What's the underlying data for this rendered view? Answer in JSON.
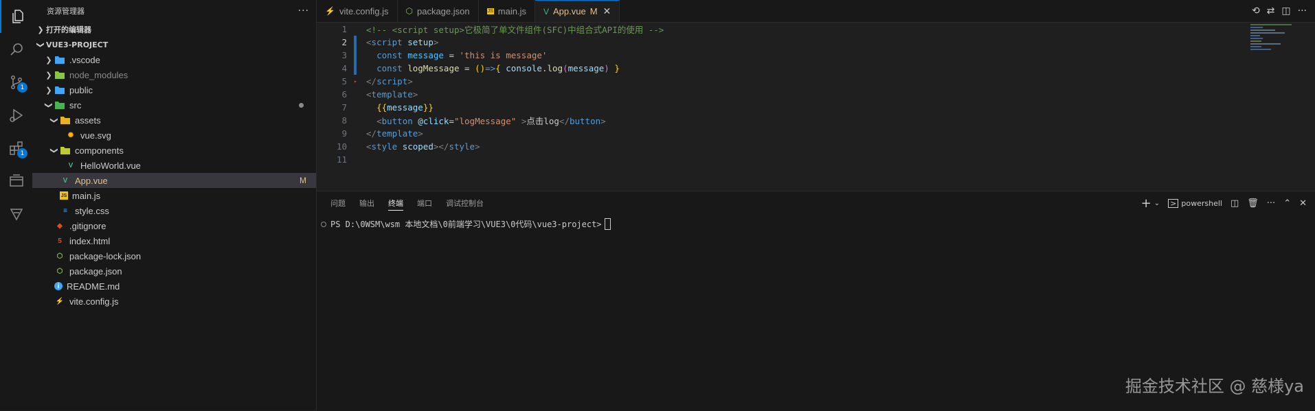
{
  "activity_bar": {
    "items": [
      {
        "icon": "files-icon",
        "badge": ""
      },
      {
        "icon": "search-icon",
        "badge": ""
      },
      {
        "icon": "source-control-icon",
        "badge": "1"
      },
      {
        "icon": "run-debug-icon",
        "badge": ""
      },
      {
        "icon": "extensions-icon",
        "badge": "1"
      },
      {
        "icon": "remote-explorer-icon",
        "badge": ""
      },
      {
        "icon": "testing-icon",
        "badge": ""
      }
    ]
  },
  "sidebar": {
    "title": "资源管理器",
    "more": "···",
    "open_editors": "打开的编辑器",
    "project": "VUE3-PROJECT",
    "tree": [
      {
        "name": ".vscode",
        "type": "folder",
        "depth": 0,
        "open": false,
        "icon_color": "#42a5f5",
        "status": ""
      },
      {
        "name": "node_modules",
        "type": "folder",
        "depth": 0,
        "open": false,
        "icon_color": "#8bc34a",
        "status": "",
        "dim": true
      },
      {
        "name": "public",
        "type": "folder",
        "depth": 0,
        "open": false,
        "icon_color": "#42a5f5",
        "status": ""
      },
      {
        "name": "src",
        "type": "folder",
        "depth": 0,
        "open": true,
        "icon_color": "#4caf50",
        "status": "dot"
      },
      {
        "name": "assets",
        "type": "folder",
        "depth": 1,
        "open": true,
        "icon_color": "#e6b422",
        "status": ""
      },
      {
        "name": "vue.svg",
        "type": "file",
        "depth": 2,
        "icon": "svg-icon",
        "icon_color": "#ffb300",
        "status": ""
      },
      {
        "name": "components",
        "type": "folder",
        "depth": 1,
        "open": true,
        "icon_color": "#c0ca33",
        "status": ""
      },
      {
        "name": "HelloWorld.vue",
        "type": "file",
        "depth": 2,
        "icon": "vue-icon",
        "icon_color": "#41b883",
        "status": ""
      },
      {
        "name": "App.vue",
        "type": "file",
        "depth": 1,
        "icon": "vue-icon",
        "icon_color": "#41b883",
        "status": "M",
        "selected": true,
        "mod": true
      },
      {
        "name": "main.js",
        "type": "file",
        "depth": 1,
        "icon": "js-icon",
        "icon_color": "#f1c40f",
        "status": ""
      },
      {
        "name": "style.css",
        "type": "file",
        "depth": 1,
        "icon": "css-icon",
        "icon_color": "#42a5f5",
        "status": ""
      },
      {
        "name": ".gitignore",
        "type": "file",
        "depth": 0,
        "icon": "git-icon",
        "icon_color": "#e64a19",
        "status": ""
      },
      {
        "name": "index.html",
        "type": "file",
        "depth": 0,
        "icon": "html-icon",
        "icon_color": "#e44d26",
        "status": ""
      },
      {
        "name": "package-lock.json",
        "type": "file",
        "depth": 0,
        "icon": "node-icon",
        "icon_color": "#8bc34a",
        "status": ""
      },
      {
        "name": "package.json",
        "type": "file",
        "depth": 0,
        "icon": "node-icon",
        "icon_color": "#8bc34a",
        "status": ""
      },
      {
        "name": "README.md",
        "type": "file",
        "depth": 0,
        "icon": "info-icon",
        "icon_color": "#42a5f5",
        "status": ""
      },
      {
        "name": "vite.config.js",
        "type": "file",
        "depth": 0,
        "icon": "vite-icon",
        "icon_color": "#ffc107",
        "status": ""
      }
    ]
  },
  "tabs": [
    {
      "label": "vite.config.js",
      "icon": "vite-icon",
      "active": false
    },
    {
      "label": "package.json",
      "icon": "node-icon",
      "active": false
    },
    {
      "label": "main.js",
      "icon": "js-icon",
      "active": false
    },
    {
      "label": "App.vue",
      "icon": "vue-icon",
      "active": true,
      "modified": "M"
    }
  ],
  "editor": {
    "current_line": 2,
    "lines": [
      {
        "n": "1",
        "tokens": [
          [
            "c-comment",
            "<!-- <script "
          ],
          [
            "c-comment",
            "setup"
          ],
          [
            "c-comment",
            ">它极简了单文件组件(SFC)中组合式API的使用 -->"
          ]
        ]
      },
      {
        "n": "2",
        "tokens": [
          [
            "c-punc",
            "<"
          ],
          [
            "c-tag",
            "script"
          ],
          [
            "c-text",
            " "
          ],
          [
            "c-attr",
            "setup"
          ],
          [
            "c-punc",
            ">"
          ]
        ]
      },
      {
        "n": "3",
        "tokens": [
          [
            "c-text",
            "  "
          ],
          [
            "c-kw",
            "const"
          ],
          [
            "c-text",
            " "
          ],
          [
            "c-var",
            "message"
          ],
          [
            "c-text",
            " = "
          ],
          [
            "c-str",
            "'this is message'"
          ]
        ]
      },
      {
        "n": "4",
        "tokens": [
          [
            "c-text",
            "  "
          ],
          [
            "c-kw",
            "const"
          ],
          [
            "c-text",
            " "
          ],
          [
            "c-fn",
            "logMessage"
          ],
          [
            "c-text",
            " = "
          ],
          [
            "c-br",
            "()"
          ],
          [
            "c-kw",
            "=>"
          ],
          [
            "c-br",
            "{"
          ],
          [
            "c-text",
            " "
          ],
          [
            "c-attr",
            "console"
          ],
          [
            "c-text",
            "."
          ],
          [
            "c-fn",
            "log"
          ],
          [
            "c-br2",
            "("
          ],
          [
            "c-attr",
            "message"
          ],
          [
            "c-br2",
            ")"
          ],
          [
            "c-text",
            " "
          ],
          [
            "c-br",
            "}"
          ]
        ]
      },
      {
        "n": "5",
        "tokens": [
          [
            "c-punc",
            "</"
          ],
          [
            "c-tag",
            "script"
          ],
          [
            "c-punc",
            ">"
          ]
        ]
      },
      {
        "n": "6",
        "tokens": [
          [
            "c-punc",
            "<"
          ],
          [
            "c-tag",
            "template"
          ],
          [
            "c-punc",
            ">"
          ]
        ]
      },
      {
        "n": "7",
        "tokens": [
          [
            "c-text",
            "  "
          ],
          [
            "c-br",
            "{{"
          ],
          [
            "c-attr",
            "message"
          ],
          [
            "c-br",
            "}}"
          ]
        ]
      },
      {
        "n": "8",
        "tokens": [
          [
            "c-text",
            "  "
          ],
          [
            "c-punc",
            "<"
          ],
          [
            "c-tag",
            "button"
          ],
          [
            "c-text",
            " "
          ],
          [
            "c-attr",
            "@click"
          ],
          [
            "c-text",
            "="
          ],
          [
            "c-str",
            "\"logMessage\""
          ],
          [
            "c-text",
            " "
          ],
          [
            "c-punc",
            ">"
          ],
          [
            "c-text",
            "点击log"
          ],
          [
            "c-punc",
            "</"
          ],
          [
            "c-tag",
            "button"
          ],
          [
            "c-punc",
            ">"
          ]
        ]
      },
      {
        "n": "9",
        "tokens": [
          [
            "c-punc",
            "</"
          ],
          [
            "c-tag",
            "template"
          ],
          [
            "c-punc",
            ">"
          ]
        ]
      },
      {
        "n": "10",
        "tokens": [
          [
            "c-punc",
            "<"
          ],
          [
            "c-tag",
            "style"
          ],
          [
            "c-text",
            " "
          ],
          [
            "c-attr",
            "scoped"
          ],
          [
            "c-punc",
            "></"
          ],
          [
            "c-tag",
            "style"
          ],
          [
            "c-punc",
            ">"
          ]
        ]
      },
      {
        "n": "11",
        "tokens": []
      }
    ]
  },
  "panel": {
    "tabs": [
      {
        "label": "问题",
        "active": false
      },
      {
        "label": "输出",
        "active": false
      },
      {
        "label": "终端",
        "active": true
      },
      {
        "label": "端口",
        "active": false
      },
      {
        "label": "调试控制台",
        "active": false
      }
    ],
    "shell": "powershell",
    "prompt": "PS D:\\0WSM\\wsm 本地文档\\0前端学习\\VUE3\\0代码\\vue3-project>"
  },
  "watermark": "掘金技术社区 @ 慈様ya"
}
